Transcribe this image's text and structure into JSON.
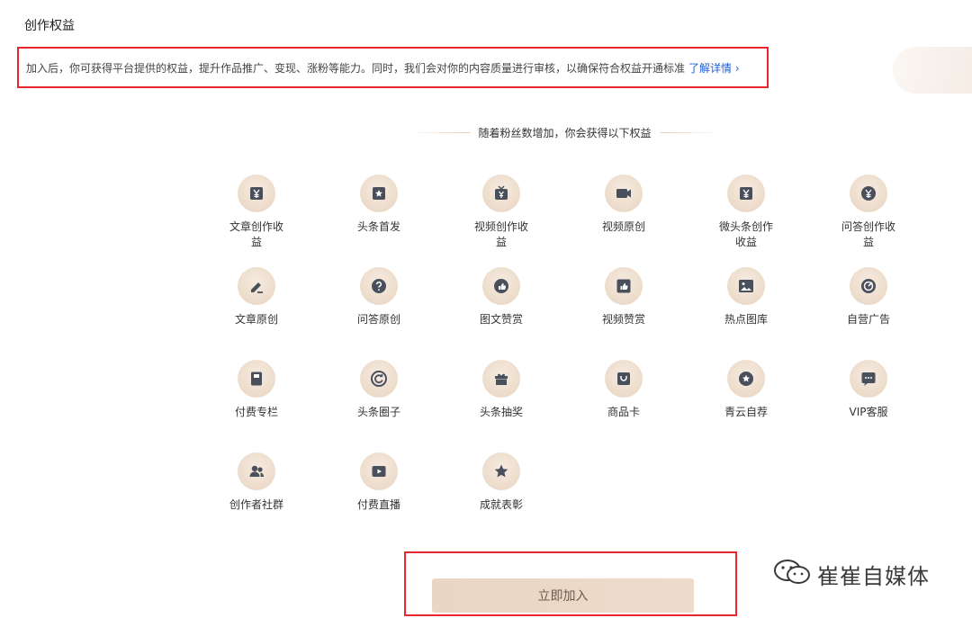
{
  "page": {
    "title": "创作权益",
    "intro": "加入后，你可获得平台提供的权益，提升作品推广、变现、涨粉等能力。同时，我们会对你的内容质量进行审核，以确保符合权益开通标准",
    "intro_link": "了解详情",
    "divider_text": "随着粉丝数增加，你会获得以下权益"
  },
  "benefits": [
    {
      "label": "文章创作收益",
      "icon": "yuan-icon"
    },
    {
      "label": "头条首发",
      "icon": "star-badge-icon"
    },
    {
      "label": "视频创作收益",
      "icon": "tv-yuan-icon"
    },
    {
      "label": "视频原创",
      "icon": "video-camera-icon"
    },
    {
      "label": "微头条创作收益",
      "icon": "yuan-icon"
    },
    {
      "label": "问答创作收益",
      "icon": "yuan-circle-icon"
    },
    {
      "label": "文章原创",
      "icon": "pen-icon"
    },
    {
      "label": "问答原创",
      "icon": "question-icon"
    },
    {
      "label": "图文赞赏",
      "icon": "thumbs-up-icon"
    },
    {
      "label": "视频赞赏",
      "icon": "thumbs-up-box-icon"
    },
    {
      "label": "热点图库",
      "icon": "image-icon"
    },
    {
      "label": "自营广告",
      "icon": "gauge-icon"
    },
    {
      "label": "付费专栏",
      "icon": "book-icon"
    },
    {
      "label": "头条圈子",
      "icon": "circle-arrow-icon"
    },
    {
      "label": "头条抽奖",
      "icon": "gift-icon"
    },
    {
      "label": "商品卡",
      "icon": "shopping-bag-icon"
    },
    {
      "label": "青云自荐",
      "icon": "star-circle-icon"
    },
    {
      "label": "VIP客服",
      "icon": "chat-icon"
    },
    {
      "label": "创作者社群",
      "icon": "users-icon"
    },
    {
      "label": "付费直播",
      "icon": "live-camera-icon"
    },
    {
      "label": "成就表彰",
      "icon": "trophy-star-icon"
    }
  ],
  "join_button": "立即加入",
  "watermark": "崔崔自媒体",
  "colors": {
    "highlight_border": "#e8262b",
    "link": "#1c5fd6",
    "icon_fill": "#4a4f5c",
    "icon_bg": "#eddcca",
    "button_bg": "#ead8c7"
  }
}
